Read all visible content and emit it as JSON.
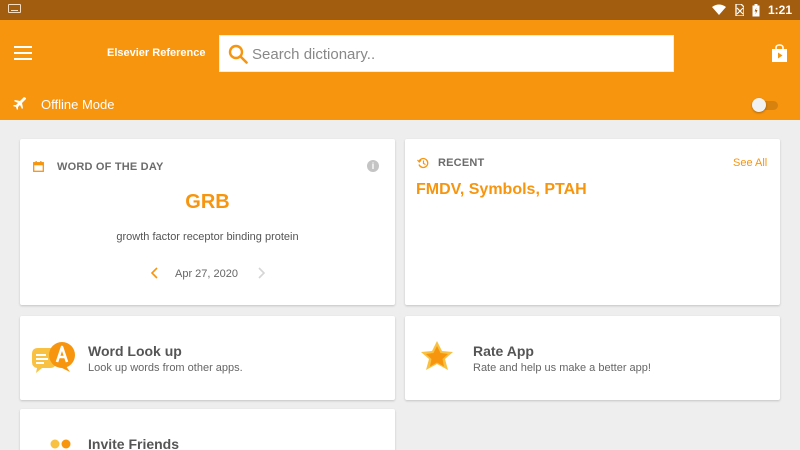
{
  "statusbar": {
    "time": "1:21"
  },
  "appbar": {
    "title": "Elsevier Reference",
    "search_placeholder": "Search dictionary..",
    "offline_label": "Offline Mode",
    "offline_enabled": false
  },
  "word_of_day": {
    "heading": "WORD OF THE DAY",
    "word": "GRB",
    "definition": "growth factor receptor binding protein",
    "date": "Apr 27, 2020"
  },
  "recent": {
    "heading": "RECENT",
    "see_all": "See All",
    "words": "FMDV, Symbols, PTAH"
  },
  "features": {
    "lookup": {
      "title": "Word Look up",
      "subtitle": "Look up words from other apps."
    },
    "rate": {
      "title": "Rate App",
      "subtitle": "Rate and help us make a better app!"
    },
    "invite": {
      "title": "Invite Friends"
    }
  },
  "colors": {
    "accent": "#f7950f",
    "statusbar": "#a35d0f",
    "background": "#eeeeee"
  },
  "icons": [
    "keyboard-icon",
    "wifi-icon",
    "no-sim-icon",
    "battery-icon",
    "menu-icon",
    "search-icon",
    "store-bag-icon",
    "airplane-icon",
    "calendar-icon",
    "info-icon",
    "history-icon",
    "chevron-left-icon",
    "chevron-right-icon",
    "lookup-bubble-icon",
    "star-icon",
    "invite-icon"
  ]
}
